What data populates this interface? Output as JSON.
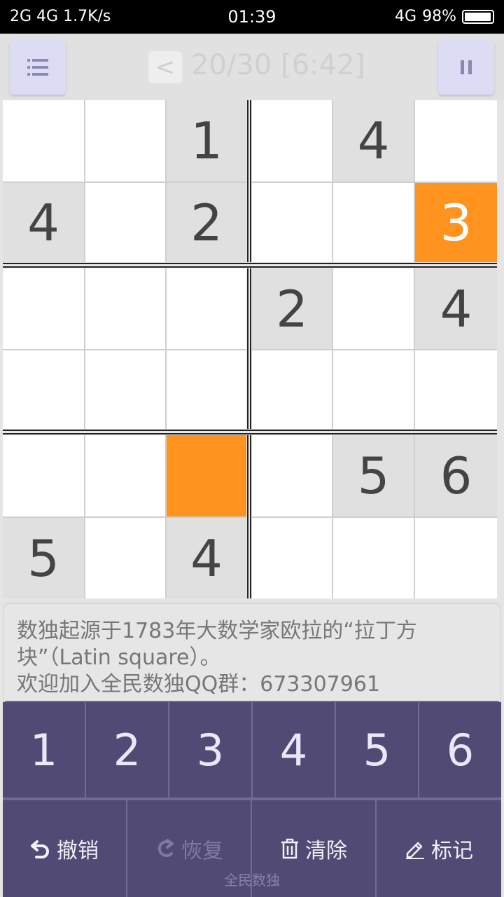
{
  "status_bar": {
    "left": "2G 4G 1.7K/s",
    "time": "01:39",
    "network": "4G",
    "battery": "98%"
  },
  "header": {
    "back_label": "<",
    "title": "20/30 [6:42]"
  },
  "board": {
    "cells": [
      {
        "value": "",
        "style": "white"
      },
      {
        "value": "",
        "style": "white"
      },
      {
        "value": "1",
        "style": "given"
      },
      {
        "value": "",
        "style": "white"
      },
      {
        "value": "4",
        "style": "given"
      },
      {
        "value": "",
        "style": "white"
      },
      {
        "value": "4",
        "style": "given"
      },
      {
        "value": "",
        "style": "white"
      },
      {
        "value": "2",
        "style": "given"
      },
      {
        "value": "",
        "style": "white"
      },
      {
        "value": "",
        "style": "white"
      },
      {
        "value": "3",
        "style": "orange"
      },
      {
        "value": "",
        "style": "white"
      },
      {
        "value": "",
        "style": "white"
      },
      {
        "value": "",
        "style": "white"
      },
      {
        "value": "2",
        "style": "given"
      },
      {
        "value": "",
        "style": "white"
      },
      {
        "value": "4",
        "style": "given"
      },
      {
        "value": "",
        "style": "white"
      },
      {
        "value": "",
        "style": "white"
      },
      {
        "value": "",
        "style": "white"
      },
      {
        "value": "",
        "style": "white"
      },
      {
        "value": "",
        "style": "white"
      },
      {
        "value": "",
        "style": "white"
      },
      {
        "value": "",
        "style": "white"
      },
      {
        "value": "",
        "style": "white"
      },
      {
        "value": "",
        "style": "orange"
      },
      {
        "value": "",
        "style": "white"
      },
      {
        "value": "5",
        "style": "given"
      },
      {
        "value": "6",
        "style": "given"
      },
      {
        "value": "5",
        "style": "given"
      },
      {
        "value": "",
        "style": "white"
      },
      {
        "value": "4",
        "style": "given"
      },
      {
        "value": "",
        "style": "white"
      },
      {
        "value": "",
        "style": "white"
      },
      {
        "value": "",
        "style": "white"
      }
    ]
  },
  "info": {
    "line1": "数独起源于1783年大数学家欧拉的“拉丁方块”（Latin square）。",
    "line2": "欢迎加入全民数独QQ群：673307961"
  },
  "keypad": {
    "numbers": [
      "1",
      "2",
      "3",
      "4",
      "5",
      "6"
    ],
    "undo_label": "撤销",
    "redo_label": "恢复",
    "clear_label": "清除",
    "mark_label": "标记"
  },
  "footer": "全民数独",
  "colors": {
    "highlight": "#ff931e",
    "keypad": "#504a75",
    "given_cell": "#e0e0e0"
  }
}
